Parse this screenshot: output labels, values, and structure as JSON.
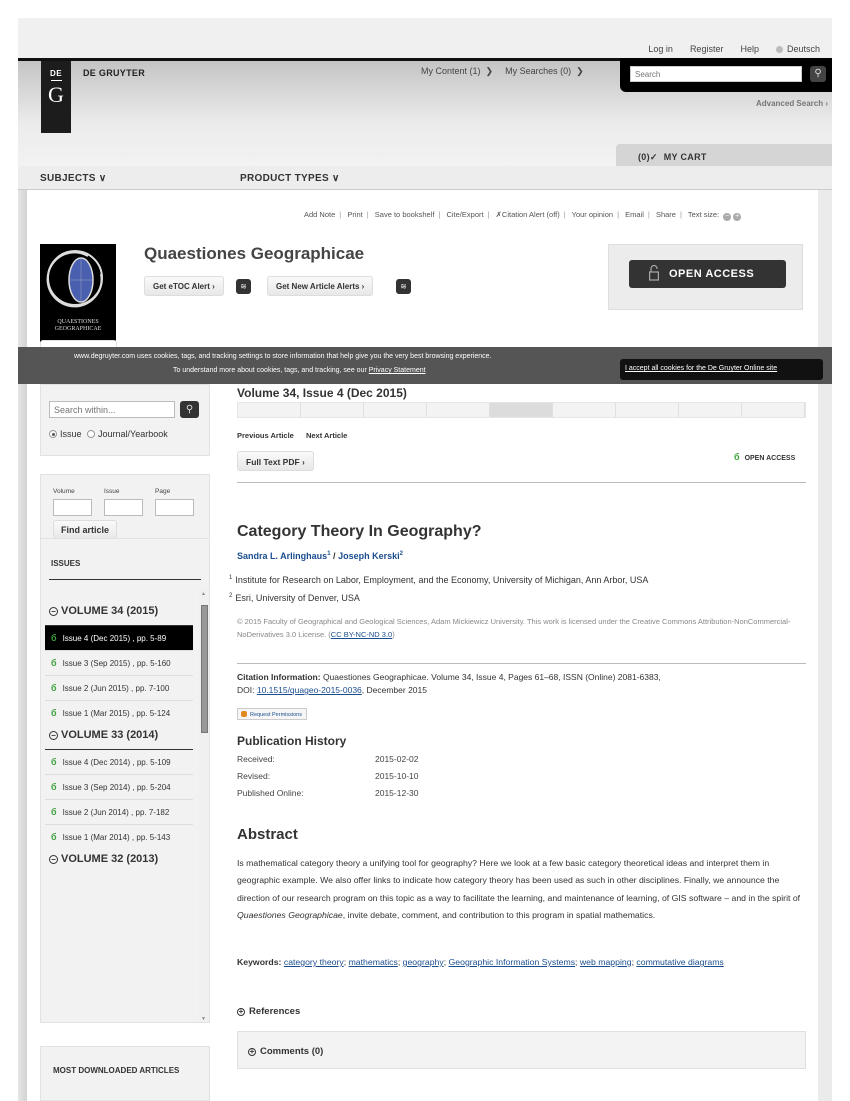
{
  "topbar": {
    "links": [
      "Log in",
      "Register",
      "Help"
    ],
    "language": "Deutsch"
  },
  "header": {
    "logo_top": "DE",
    "logo_bottom": "G",
    "brand": "DE GRUYTER",
    "my_content": "My Content (1)",
    "my_searches": "My Searches (0)",
    "search_placeholder": "Search",
    "advanced_search": "Advanced Search ›",
    "cart_count": "(0)",
    "cart_label": "MY CART"
  },
  "nav": {
    "subjects": "SUBJECTS ∨",
    "product_types": "PRODUCT TYPES ∨"
  },
  "toolbar": {
    "items": [
      "Add Note",
      "Print",
      "Save to bookshelf",
      "Cite/Export",
      "Citation Alert (off)",
      "Your opinion",
      "Email",
      "Share"
    ],
    "text_size": "Text size:"
  },
  "journal": {
    "title": "Quaestiones Geographicae",
    "cover_text_1": "QUAESTIONES",
    "cover_text_2": "GEOGRAPHICAE",
    "etoc_button": "Get eTOC Alert ›",
    "new_article_button": "Get New Article Alerts ›",
    "open_access": "OPEN ACCESS"
  },
  "cookie": {
    "line1": "www.degruyter.com uses cookies, tags, and tracking settings to store information that help give you the very best browsing experience.",
    "line2": "To understand more about cookies, tags, and tracking, see our",
    "privacy_link": "Privacy Statement",
    "accept": "I accept all cookies for the De Gruyter Online site"
  },
  "sidebar": {
    "search_placeholder": "Search within...",
    "scope_issue": "Issue",
    "scope_journal": "Journal/Yearbook",
    "volume_label": "Volume",
    "issue_label": "Issue",
    "page_label": "Page",
    "find_article": "Find article",
    "issues_header": "ISSUES",
    "volumes": [
      {
        "title": "VOLUME 34 (2015)",
        "issues": [
          {
            "label": "Issue 4 (Dec 2015) , pp. 5-89",
            "active": true
          },
          {
            "label": "Issue 3 (Sep 2015) , pp. 5-160",
            "active": false
          },
          {
            "label": "Issue 2 (Jun 2015) , pp. 7-100",
            "active": false
          },
          {
            "label": "Issue 1 (Mar 2015) , pp. 5-124",
            "active": false
          }
        ]
      },
      {
        "title": "VOLUME 33 (2014)",
        "issues": [
          {
            "label": "Issue 4 (Dec 2014) , pp. 5-109",
            "active": false
          },
          {
            "label": "Issue 3 (Sep 2014) , pp. 5-204",
            "active": false
          },
          {
            "label": "Issue 2 (Jun 2014) , pp. 7-182",
            "active": false
          },
          {
            "label": "Issue 1 (Mar 2014) , pp. 5-143",
            "active": false
          }
        ]
      },
      {
        "title": "VOLUME 32 (2013)",
        "issues": []
      }
    ],
    "most_downloaded": "MOST DOWNLOADED ARTICLES"
  },
  "article": {
    "volume_issue": "Volume 34, Issue 4 (Dec 2015)",
    "previous": "Previous Article",
    "next": "Next Article",
    "full_text_pdf": "Full Text PDF  ›",
    "open_access": "OPEN ACCESS",
    "title": "Category Theory In Geography?",
    "authors": [
      {
        "name": "Sandra L. Arlinghaus",
        "sup": "1"
      },
      {
        "name": "Joseph Kerski",
        "sup": "2"
      }
    ],
    "affiliations": [
      {
        "sup": "1",
        "text": "Institute for Research on Labor, Employment, and the Economy, University of Michigan, Ann Arbor, USA"
      },
      {
        "sup": "2",
        "text": "Esri, University of Denver, USA"
      }
    ],
    "license_text": "© 2015 Faculty of Geographical and Geological Sciences, Adam Mickiewicz University. This work is licensed under the Creative Commons Attribution-NonCommercial-NoDerivatives 3.0 License. (",
    "license_link": "CC BY-NC-ND 3.0",
    "citation_label": "Citation Information:",
    "citation_text": " Quaestiones Geographicae. Volume 34, Issue 4, Pages 61–68, ISSN (Online) 2081-6383,",
    "doi_label": "DOI: ",
    "doi": "10.1515/quageo-2015-0036",
    "doi_suffix": ", December 2015",
    "request_permissions": "Request Permissions",
    "history_title": "Publication History",
    "history": [
      {
        "label": "Received:",
        "date": "2015-02-02"
      },
      {
        "label": "Revised:",
        "date": "2015-10-10"
      },
      {
        "label": "Published Online:",
        "date": "2015-12-30"
      }
    ],
    "abstract_title": "Abstract",
    "abstract_before": "Is mathematical category theory a unifying tool for geography? Here we look at a few basic category theoretical ideas and interpret them in geographic example. We also offer links to indicate how category theory has been used as such in other disciplines. Finally, we announce the direction of our research program on this topic as a way to facilitate the learning, and maintenance of learning, of GIS software – and in the spirit of ",
    "abstract_italic": "Quaestiones Geographicae",
    "abstract_after": ", invite debate, comment, and contribution to this program in spatial mathematics.",
    "keywords_label": "Keywords:",
    "keywords": [
      "category theory",
      "mathematics",
      "geography",
      "Geographic Information Systems",
      "web mapping",
      "commutative diagrams"
    ],
    "references": "References",
    "comments": "Comments (0)"
  }
}
